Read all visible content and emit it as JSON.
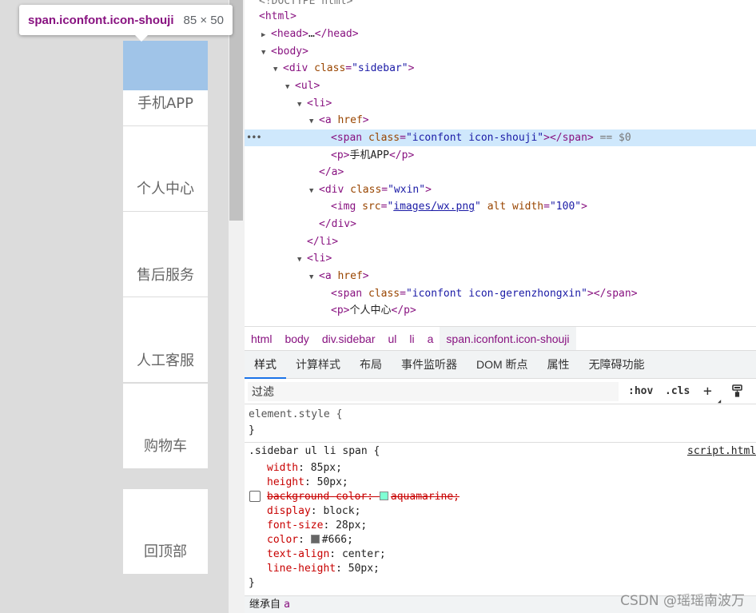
{
  "tooltip": {
    "selector": "span.iconfont.icon-shouji",
    "size": "85 × 50"
  },
  "sidebar": {
    "items": [
      {
        "label": "手机APP"
      },
      {
        "label": "个人中心"
      },
      {
        "label": "售后服务"
      },
      {
        "label": "人工客服"
      },
      {
        "label": "购物车"
      },
      {
        "label": "回顶部"
      }
    ]
  },
  "dom": {
    "doctype": "<!DOCTYPE html>",
    "html_open": "<html>",
    "head_tag": "<head>",
    "head_ell": "…",
    "head_close": "</head>",
    "body_open": "<body>",
    "div_open": "<div",
    "class_attr": "class",
    "sidebar_class": "\"sidebar\"",
    "gt": ">",
    "ul_open": "<ul>",
    "li_open": "<li>",
    "a_open": "<a",
    "href_attr": "href",
    "span_open": "<span",
    "span_class1": "\"iconfont icon-shouji\"",
    "span_close": "></span>",
    "selected_marker": "== $0",
    "p_open": "<p>",
    "p_text1": "手机APP",
    "p_close": "</p>",
    "a_close": "</a>",
    "wxin_class": "\"wxin\"",
    "img_open": "<img",
    "src_attr": "src",
    "img_src": "images/wx.png",
    "alt_attr": "alt",
    "width_attr": "width",
    "width_val": "\"100\"",
    "div_close": "</div>",
    "li_close": "</li>",
    "span_class2": "\"iconfont icon-gerenzhongxin\"",
    "p_text2": "个人中心",
    "eq": "=",
    "quote": "\""
  },
  "breadcrumb": [
    "html",
    "body",
    "div.sidebar",
    "ul",
    "li",
    "a",
    "span.iconfont.icon-shouji"
  ],
  "tabs": [
    "样式",
    "计算样式",
    "布局",
    "事件监听器",
    "DOM 断点",
    "属性",
    "无障碍功能"
  ],
  "filter": {
    "placeholder": "过滤",
    "hov": ":hov",
    "cls": ".cls",
    "plus": "+"
  },
  "styles": {
    "element_style": "element.style {",
    "close_brace": "}",
    "rule_selector": ".sidebar ul li span {",
    "source": "script.html",
    "props": [
      {
        "name": "width",
        "value": "85px;"
      },
      {
        "name": "height",
        "value": "50px;"
      },
      {
        "name": "background-color",
        "value": "aquamarine;"
      },
      {
        "name": "display",
        "value": "block;"
      },
      {
        "name": "font-size",
        "value": "28px;"
      },
      {
        "name": "color",
        "value": "#666;"
      },
      {
        "name": "text-align",
        "value": "center;"
      },
      {
        "name": "line-height",
        "value": "50px;"
      }
    ],
    "inherited_label": "继承自",
    "inherited_tag": "a",
    "swatch_aquamarine": "#7fffd4",
    "swatch_666": "#666666"
  },
  "watermark": "CSDN @瑶瑶南波万",
  "colors": {
    "highlight": "#a0c4e8",
    "selected_row": "#cfe8fc",
    "tag": "#881280",
    "attr_name": "#994500",
    "attr_value": "#1a1aa6"
  }
}
